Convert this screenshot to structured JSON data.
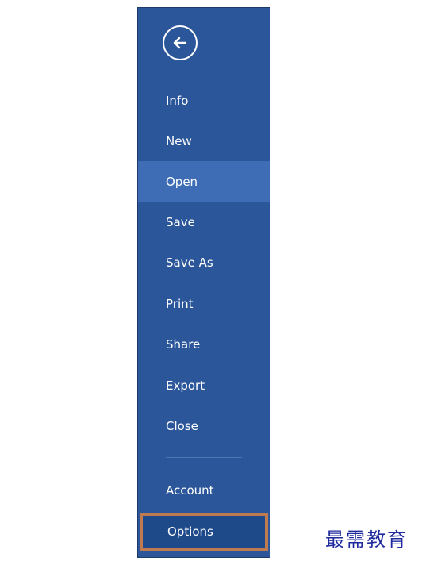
{
  "backstage": {
    "back_icon": "arrow-left-circle-icon",
    "items": [
      {
        "label": "Info"
      },
      {
        "label": "New"
      },
      {
        "label": "Open"
      },
      {
        "label": "Save"
      },
      {
        "label": "Save As"
      },
      {
        "label": "Print"
      },
      {
        "label": "Share"
      },
      {
        "label": "Export"
      },
      {
        "label": "Close"
      }
    ],
    "account_label": "Account",
    "options_label": "Options"
  },
  "watermark": {
    "text": "最需教育"
  },
  "colors": {
    "panel_background": "#2b579a",
    "hover_background": "#3e6db5",
    "highlight_outline": "#c07a52",
    "text": "#ffffff"
  }
}
